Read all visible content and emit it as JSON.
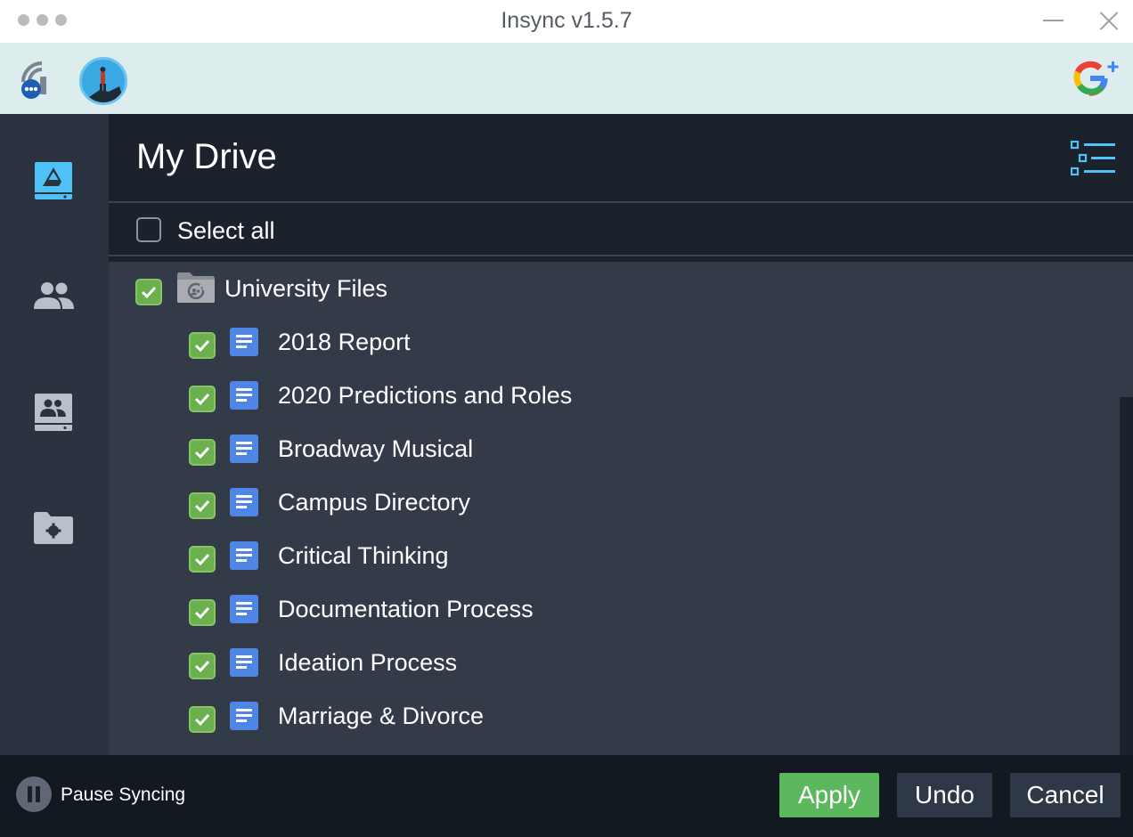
{
  "window": {
    "title": "Insync v1.5.7"
  },
  "header": {
    "title": "My Drive"
  },
  "select_all": {
    "label": "Select all",
    "checked": false
  },
  "tree": [
    {
      "label": "University Files",
      "type": "shared-folder",
      "level": 0,
      "checked": true
    },
    {
      "label": "2018 Report",
      "type": "doc",
      "level": 1,
      "checked": true
    },
    {
      "label": "2020 Predictions and Roles",
      "type": "doc",
      "level": 1,
      "checked": true
    },
    {
      "label": "Broadway Musical",
      "type": "doc",
      "level": 1,
      "checked": true
    },
    {
      "label": "Campus Directory",
      "type": "doc",
      "level": 1,
      "checked": true
    },
    {
      "label": "Critical Thinking",
      "type": "doc",
      "level": 1,
      "checked": true
    },
    {
      "label": "Documentation Process",
      "type": "doc",
      "level": 1,
      "checked": true
    },
    {
      "label": "Ideation Process",
      "type": "doc",
      "level": 1,
      "checked": true
    },
    {
      "label": "Marriage & Divorce",
      "type": "doc",
      "level": 1,
      "checked": true
    }
  ],
  "footer": {
    "pause_label": "Pause Syncing",
    "apply_label": "Apply",
    "undo_label": "Undo",
    "cancel_label": "Cancel"
  },
  "sidebar": {
    "items": [
      {
        "icon": "google-drive-icon",
        "active": true
      },
      {
        "icon": "shared-people-icon",
        "active": false
      },
      {
        "icon": "team-drive-icon",
        "active": false
      },
      {
        "icon": "folder-settings-icon",
        "active": false
      }
    ]
  },
  "colors": {
    "accent": "#4fc3f7",
    "checkbox_green": "#6ab04c",
    "apply_green": "#5cb85c",
    "doc_blue": "#4f86e6"
  }
}
